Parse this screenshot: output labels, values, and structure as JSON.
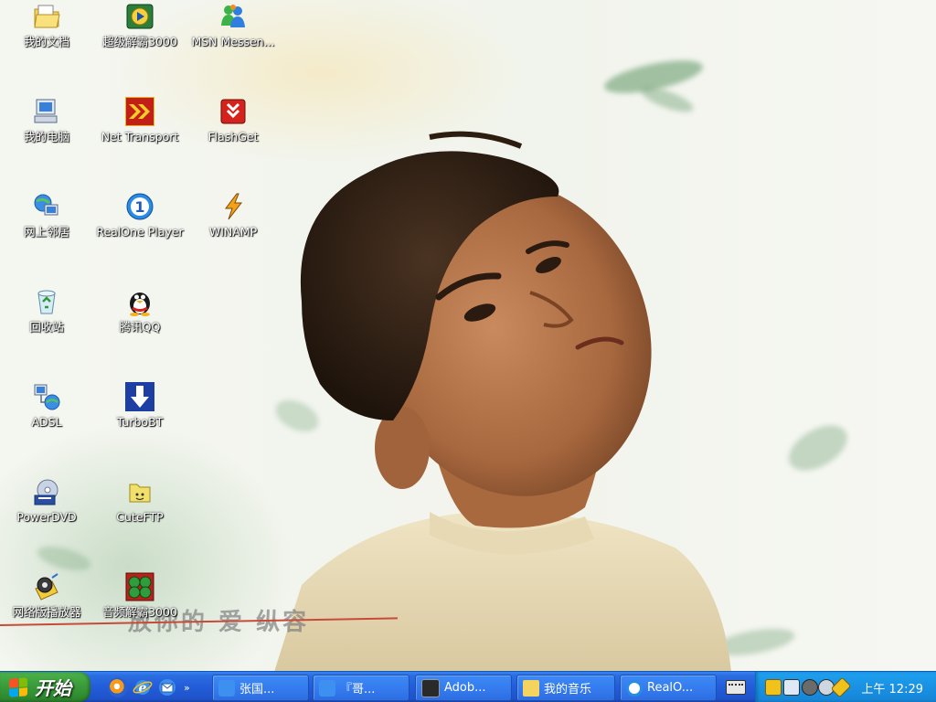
{
  "desktop": {
    "icons": [
      {
        "label": "我的文档",
        "icon": "my-documents-icon"
      },
      {
        "label": "超级解霸3000",
        "icon": "superdecoder-icon"
      },
      {
        "label": "MSN Messen...",
        "icon": "msn-messenger-icon"
      },
      {
        "label": "我的电脑",
        "icon": "my-computer-icon"
      },
      {
        "label": "Net Transport",
        "icon": "net-transport-icon"
      },
      {
        "label": "FlashGet",
        "icon": "flashget-icon"
      },
      {
        "label": "网上邻居",
        "icon": "network-places-icon"
      },
      {
        "label": "RealOne Player",
        "icon": "realone-player-icon"
      },
      {
        "label": "WINAMP",
        "icon": "winamp-icon"
      },
      {
        "label": "回收站",
        "icon": "recycle-bin-icon"
      },
      {
        "label": "腾讯QQ",
        "icon": "qq-penguin-icon"
      },
      {
        "label": "ADSL",
        "icon": "adsl-connection-icon"
      },
      {
        "label": "TurboBT",
        "icon": "turbobt-icon"
      },
      {
        "label": "PowerDVD",
        "icon": "powerdvd-icon"
      },
      {
        "label": "CuteFTP",
        "icon": "cuteftp-icon"
      },
      {
        "label": "网络版播放器",
        "icon": "network-player-icon"
      },
      {
        "label": "音频解霸3000",
        "icon": "audio-decoder-icon"
      }
    ]
  },
  "wallpaper": {
    "caption": "放你的 爱  纵容"
  },
  "taskbar": {
    "start_label": "开始",
    "quick_launch": [
      "media-player-icon",
      "internet-explorer-icon",
      "outlook-express-icon"
    ],
    "quick_launch_more": "»",
    "tasks": [
      {
        "label": "张国...",
        "icon": "ie-window-icon"
      },
      {
        "label": "『哥...",
        "icon": "ie-window-icon"
      },
      {
        "label": "Adob...",
        "icon": "adobe-viewer-icon"
      },
      {
        "label": "我的音乐",
        "icon": "folder-icon"
      },
      {
        "label": "RealO...",
        "icon": "realone-window-icon"
      }
    ],
    "tray_icons": [
      "keyboard-icon",
      "network-tray-icon",
      "monitor-tray-icon",
      "audio-tray-icon",
      "security-tray-icon",
      "edit-tray-icon"
    ],
    "clock": "上午 12:29"
  },
  "colors": {
    "taskbar_blue": "#245edb",
    "start_green": "#3c9e3c",
    "tray_blue": "#1b94e6"
  }
}
